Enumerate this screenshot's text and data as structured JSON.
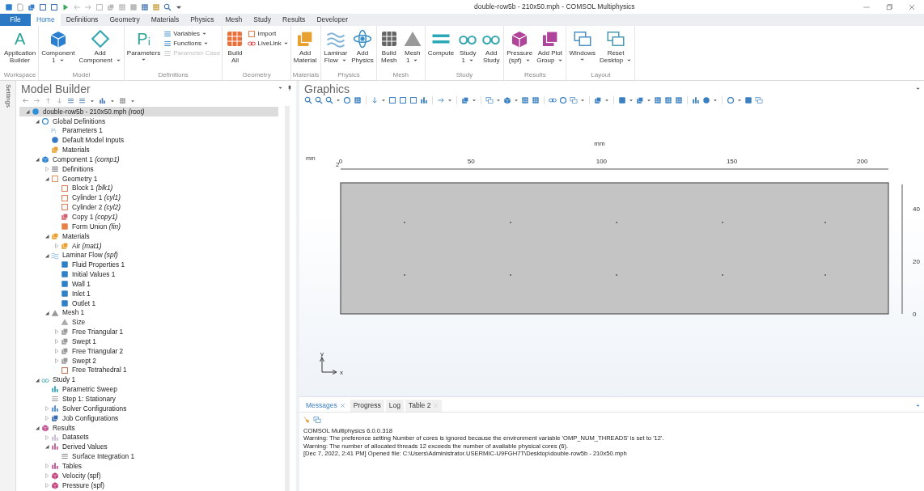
{
  "window": {
    "title": "double-row5b - 210x50.mph - COMSOL Multiphysics"
  },
  "menu_tabs": [
    {
      "label": "File",
      "kind": "file",
      "selected": false
    },
    {
      "label": "Home",
      "kind": "tab",
      "selected": true
    },
    {
      "label": "Definitions",
      "kind": "tab",
      "selected": false
    },
    {
      "label": "Geometry",
      "kind": "tab",
      "selected": false
    },
    {
      "label": "Materials",
      "kind": "tab",
      "selected": false
    },
    {
      "label": "Physics",
      "kind": "tab",
      "selected": false
    },
    {
      "label": "Mesh",
      "kind": "tab",
      "selected": false
    },
    {
      "label": "Study",
      "kind": "tab",
      "selected": false
    },
    {
      "label": "Results",
      "kind": "tab",
      "selected": false
    },
    {
      "label": "Developer",
      "kind": "tab",
      "selected": false
    }
  ],
  "ribbon": [
    {
      "label": "Workspace",
      "items": [
        {
          "kind": "glyph",
          "glyph": "A",
          "lines": [
            "Application",
            "Builder"
          ],
          "dropdown": false
        }
      ]
    },
    {
      "label": "Model",
      "items": [
        {
          "kind": "component",
          "lines": [
            "Component",
            "1"
          ],
          "dropdown": true
        },
        {
          "kind": "addcomponent",
          "lines": [
            "Add",
            "Component"
          ],
          "dropdown": true
        }
      ]
    },
    {
      "label": "Definitions",
      "items": [
        {
          "kind": "glyph",
          "glyph": "Pᵢ",
          "lines": [
            "Parameters"
          ],
          "dropdown": true
        },
        {
          "kind": "stack",
          "items": [
            {
              "kind": "variables",
              "label": "Variables",
              "dropdown": true,
              "disabled": false
            },
            {
              "kind": "functions",
              "label": "Functions",
              "dropdown": true,
              "disabled": false
            },
            {
              "kind": "paramcase",
              "label": "Parameter Case",
              "dropdown": false,
              "disabled": true
            }
          ]
        }
      ]
    },
    {
      "label": "Geometry",
      "items": [
        {
          "kind": "build",
          "lines": [
            "Build",
            "All"
          ],
          "dropdown": false
        },
        {
          "kind": "stack",
          "items": [
            {
              "kind": "import",
              "label": "Import",
              "dropdown": false,
              "disabled": false
            },
            {
              "kind": "livelink",
              "label": "LiveLink",
              "dropdown": true,
              "disabled": false
            }
          ]
        }
      ]
    },
    {
      "label": "Materials",
      "items": [
        {
          "kind": "addmaterial",
          "lines": [
            "Add",
            "Material"
          ],
          "dropdown": false
        }
      ]
    },
    {
      "label": "Physics",
      "items": [
        {
          "kind": "laminar",
          "lines": [
            "Laminar",
            "Flow"
          ],
          "dropdown": true
        },
        {
          "kind": "addphysics",
          "lines": [
            "Add",
            "Physics"
          ],
          "dropdown": false
        }
      ]
    },
    {
      "label": "Mesh",
      "items": [
        {
          "kind": "buildmesh",
          "lines": [
            "Build",
            "Mesh"
          ],
          "dropdown": false
        },
        {
          "kind": "mesh",
          "lines": [
            "Mesh",
            "1"
          ],
          "dropdown": true
        }
      ]
    },
    {
      "label": "Study",
      "items": [
        {
          "kind": "compute",
          "lines": [
            "Compute"
          ],
          "dropdown": false
        },
        {
          "kind": "study",
          "lines": [
            "Study",
            "1"
          ],
          "dropdown": true
        },
        {
          "kind": "addstudy",
          "lines": [
            "Add",
            "Study"
          ],
          "dropdown": false
        }
      ]
    },
    {
      "label": "Results",
      "items": [
        {
          "kind": "pressure",
          "lines": [
            "Pressure",
            "(spf)"
          ],
          "dropdown": true
        },
        {
          "kind": "addplot",
          "lines": [
            "Add Plot",
            "Group"
          ],
          "dropdown": true
        }
      ]
    },
    {
      "label": "Layout",
      "items": [
        {
          "kind": "windows",
          "lines": [
            "Windows"
          ],
          "dropdown": true
        },
        {
          "kind": "reset",
          "lines": [
            "Reset",
            "Desktop"
          ],
          "dropdown": true
        }
      ]
    }
  ],
  "side_tab": {
    "label": "Settings"
  },
  "model_builder": {
    "title": "Model Builder",
    "tree": [
      {
        "label": "double-row5b - 210x50.mph *(root)*",
        "kind": "root",
        "selected": true,
        "expanded": true,
        "children": [
          {
            "label": "Global Definitions",
            "kind": "global",
            "selected": false,
            "expanded": true,
            "children": [
              {
                "label": "Parameters 1",
                "kind": "glyph",
                "glyph": "Pᵢ",
                "selected": false
              },
              {
                "label": "Default Model Inputs",
                "kind": "inputs",
                "selected": false
              },
              {
                "label": "Materials",
                "kind": "materials",
                "selected": false
              }
            ]
          },
          {
            "label": "Component 1 *(comp1)*",
            "kind": "component",
            "selected": false,
            "expanded": true,
            "children": [
              {
                "label": "Definitions",
                "kind": "defs",
                "selected": false,
                "expanded": false
              },
              {
                "label": "Geometry 1",
                "kind": "geometry",
                "selected": false,
                "expanded": true,
                "children": [
                  {
                    "label": "Block 1 *(blk1)*",
                    "kind": "block",
                    "selected": false
                  },
                  {
                    "label": "Cylinder 1 *(cyl1)*",
                    "kind": "block",
                    "selected": false
                  },
                  {
                    "label": "Cylinder 2 *(cyl2)*",
                    "kind": "block",
                    "selected": false
                  },
                  {
                    "label": "Copy 1 *(copy1)*",
                    "kind": "copy",
                    "selected": false
                  },
                  {
                    "label": "Form Union *(fin)*",
                    "kind": "union",
                    "selected": false
                  }
                ]
              },
              {
                "label": "Materials",
                "kind": "materials",
                "selected": false,
                "expanded": true,
                "children": [
                  {
                    "label": "Air *(mat1)*",
                    "kind": "materials",
                    "selected": false,
                    "expanded": false
                  }
                ]
              },
              {
                "label": "Laminar Flow *(spf)*",
                "kind": "flow",
                "selected": false,
                "expanded": true,
                "children": [
                  {
                    "label": "Fluid Properties 1",
                    "kind": "feature",
                    "selected": false
                  },
                  {
                    "label": "Initial Values 1",
                    "kind": "feature",
                    "selected": false
                  },
                  {
                    "label": "Wall 1",
                    "kind": "feature",
                    "selected": false
                  },
                  {
                    "label": "Inlet 1",
                    "kind": "feature",
                    "selected": false
                  },
                  {
                    "label": "Outlet 1",
                    "kind": "feature",
                    "selected": false
                  }
                ]
              },
              {
                "label": "Mesh 1",
                "kind": "mesh",
                "selected": false,
                "expanded": true,
                "children": [
                  {
                    "label": "Size",
                    "kind": "size",
                    "selected": false
                  },
                  {
                    "label": "Free Triangular 1",
                    "kind": "meshop",
                    "selected": false,
                    "expanded": false
                  },
                  {
                    "label": "Swept 1",
                    "kind": "meshop",
                    "selected": false,
                    "expanded": false
                  },
                  {
                    "label": "Free Triangular 2",
                    "kind": "meshop",
                    "selected": false,
                    "expanded": false
                  },
                  {
                    "label": "Swept 2",
                    "kind": "meshop",
                    "selected": false,
                    "expanded": false
                  },
                  {
                    "label": "Free Tetrahedral 1",
                    "kind": "tetra",
                    "selected": false
                  }
                ]
              }
            ]
          },
          {
            "label": "Study 1",
            "kind": "study",
            "selected": false,
            "expanded": true,
            "children": [
              {
                "label": "Parametric Sweep",
                "kind": "sweep",
                "selected": false
              },
              {
                "label": "Step 1: Stationary",
                "kind": "step",
                "selected": false
              },
              {
                "label": "Solver Configurations",
                "kind": "solver",
                "selected": false,
                "expanded": false
              },
              {
                "label": "Job Configurations",
                "kind": "job",
                "selected": false,
                "expanded": false
              }
            ]
          },
          {
            "label": "Results",
            "kind": "results",
            "selected": false,
            "expanded": true,
            "children": [
              {
                "label": "Datasets",
                "kind": "dataset",
                "selected": false,
                "expanded": false
              },
              {
                "label": "Derived Values",
                "kind": "derived",
                "selected": false,
                "expanded": true,
                "children": [
                  {
                    "label": "Surface Integration 1",
                    "kind": "integration",
                    "selected": false
                  }
                ]
              },
              {
                "label": "Tables",
                "kind": "table",
                "selected": false,
                "expanded": false
              },
              {
                "label": "Velocity (spf)",
                "kind": "plot",
                "selected": false,
                "expanded": false
              },
              {
                "label": "Pressure (spf)",
                "kind": "plot",
                "selected": false,
                "expanded": false
              }
            ]
          }
        ]
      }
    ]
  },
  "graphics": {
    "title": "Graphics",
    "axis_unit": "mm",
    "corner_unit": "mm",
    "corner_digit": "2",
    "x_ticks": [
      "0",
      "50",
      "100",
      "150",
      "200"
    ],
    "y_ticks": [
      "40",
      "20",
      "0"
    ],
    "triad": {
      "x": "x",
      "y": "y"
    }
  },
  "messages": {
    "tabs": [
      {
        "label": "Messages",
        "closable": true,
        "selected": true
      },
      {
        "label": "Progress",
        "closable": false,
        "selected": false
      },
      {
        "label": "Log",
        "closable": false,
        "selected": false
      },
      {
        "label": "Table 2",
        "closable": true,
        "selected": false
      }
    ],
    "lines": [
      "COMSOL Multiphysics 6.0.0.318",
      "Warning: The preference setting Number of cores is ignored because the environment variable 'OMP_NUM_THREADS' is set to '12'.",
      "Warning: The number of allocated threads 12 exceeds the number of available physical cores (6).",
      "[Dec 7, 2022, 2:41 PM] Opened file: C:\\Users\\Administrator.USERMIC-U9FGH7T\\Desktop\\double-row5b - 210x50.mph"
    ]
  }
}
